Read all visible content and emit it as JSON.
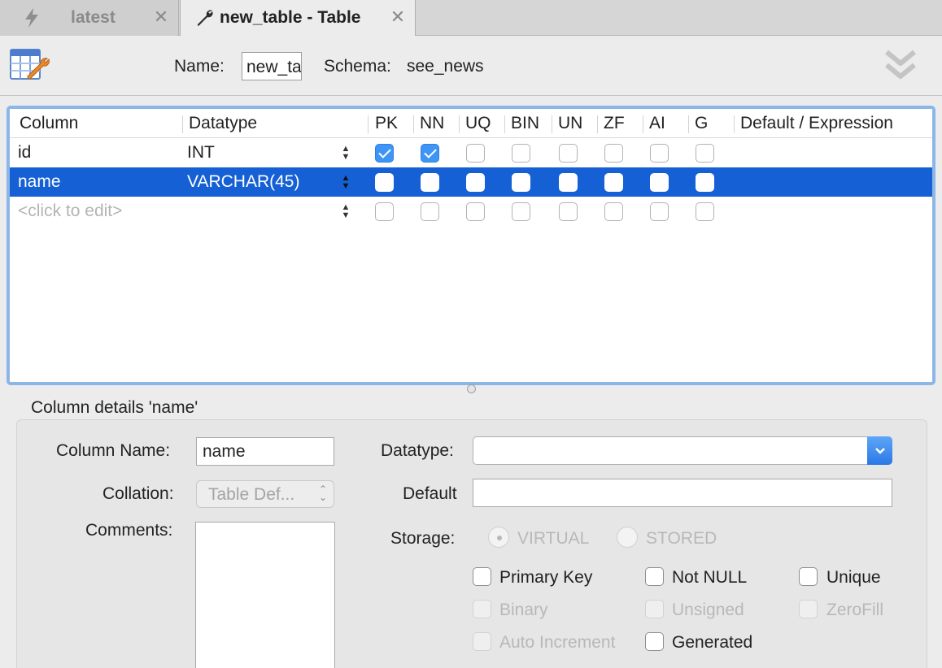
{
  "tabs": [
    {
      "title": "latest",
      "icon": "lightning-icon",
      "active": false
    },
    {
      "title": "new_table - Table",
      "icon": "wrench-icon",
      "active": true
    }
  ],
  "toolbar": {
    "name_label": "Name:",
    "name_value": "new_table",
    "schema_label": "Schema:",
    "schema_value": "see_news"
  },
  "grid": {
    "headers": [
      "Column",
      "Datatype",
      "PK",
      "NN",
      "UQ",
      "BIN",
      "UN",
      "ZF",
      "AI",
      "G",
      "Default / Expression"
    ],
    "rows": [
      {
        "column": "id",
        "datatype": "INT",
        "flags": [
          true,
          true,
          false,
          false,
          false,
          false,
          false,
          false
        ],
        "selected": false
      },
      {
        "column": "name",
        "datatype": "VARCHAR(45)",
        "flags": [
          false,
          false,
          false,
          false,
          false,
          false,
          false,
          false
        ],
        "selected": true
      },
      {
        "column": "<click to edit>",
        "datatype": "",
        "flags": [
          false,
          false,
          false,
          false,
          false,
          false,
          false,
          false
        ],
        "selected": false
      }
    ]
  },
  "details": {
    "title": "Column details 'name'",
    "column_name_label": "Column Name:",
    "column_name_value": "name",
    "collation_label": "Collation:",
    "collation_value": "Table Def...",
    "comments_label": "Comments:",
    "datatype_label": "Datatype:",
    "datatype_value": "",
    "default_label": "Default",
    "default_value": "",
    "storage_label": "Storage:",
    "storage_options": [
      "VIRTUAL",
      "STORED"
    ],
    "checkboxes": {
      "primary_key": "Primary Key",
      "not_null": "Not NULL",
      "unique": "Unique",
      "binary": "Binary",
      "unsigned": "Unsigned",
      "zerofill": "ZeroFill",
      "auto_increment": "Auto Increment",
      "generated": "Generated"
    }
  },
  "colors": {
    "selection": "#1560d4",
    "focus_ring": "#8cb6e8",
    "checkbox_on": "#3f95f5"
  }
}
